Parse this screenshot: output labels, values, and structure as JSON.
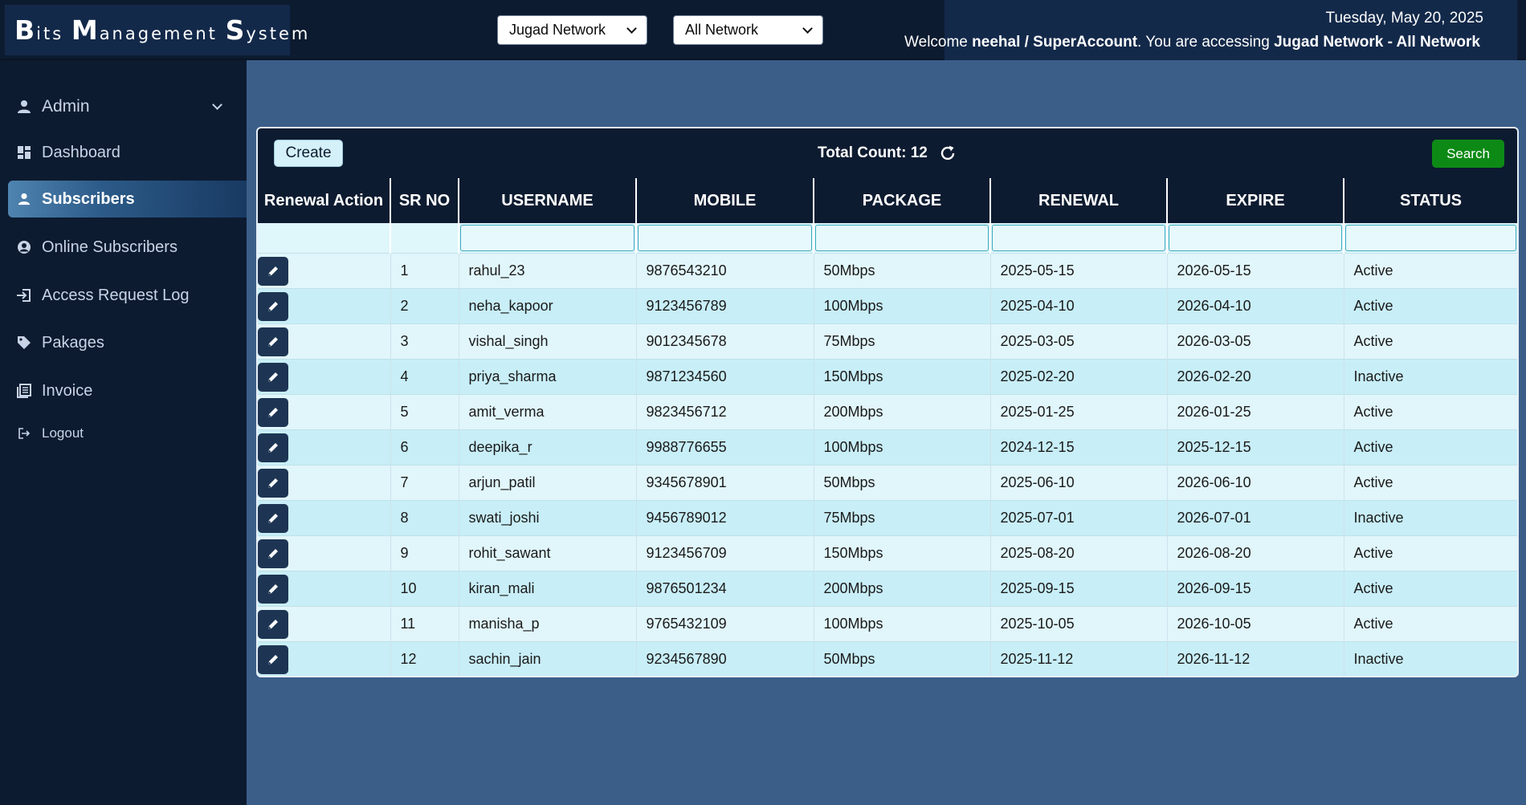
{
  "header": {
    "brand": {
      "b": "B",
      "its": "its ",
      "m": "M",
      "anagement": "anagement ",
      "s": "S",
      "ystem": "ystem"
    },
    "network_select": "Jugad Network",
    "subnetwork_select": "All Network",
    "date": "Tuesday, May 20, 2025",
    "welcome_prefix": "Welcome ",
    "user": "neehal / SuperAccount",
    "accessing_text": ". You are accessing ",
    "access_scope": "Jugad Network - All Network"
  },
  "sidebar": {
    "items": [
      {
        "label": "Admin",
        "icon": "user-icon"
      },
      {
        "label": "Dashboard",
        "icon": "dashboard-icon"
      },
      {
        "label": "Subscribers",
        "icon": "user-icon"
      },
      {
        "label": "Online Subscribers",
        "icon": "user-circle-icon"
      },
      {
        "label": "Access Request Log",
        "icon": "sign-in-icon"
      },
      {
        "label": "Pakages",
        "icon": "tag-icon"
      },
      {
        "label": "Invoice",
        "icon": "invoice-icon"
      },
      {
        "label": "Logout",
        "icon": "logout-icon"
      }
    ]
  },
  "toolbar": {
    "create_label": "Create",
    "total_count": "Total Count: 12",
    "search_label": "Search"
  },
  "table": {
    "headers": [
      "Renewal Action",
      "SR NO",
      "USERNAME",
      "MOBILE",
      "PACKAGE",
      "RENEWAL",
      "EXPIRE",
      "STATUS"
    ],
    "rows": [
      {
        "sr": "1",
        "username": "rahul_23",
        "mobile": "9876543210",
        "package": "50Mbps",
        "renewal": "2025-05-15",
        "expire": "2026-05-15",
        "status": "Active"
      },
      {
        "sr": "2",
        "username": "neha_kapoor",
        "mobile": "9123456789",
        "package": "100Mbps",
        "renewal": "2025-04-10",
        "expire": "2026-04-10",
        "status": "Active"
      },
      {
        "sr": "3",
        "username": "vishal_singh",
        "mobile": "9012345678",
        "package": "75Mbps",
        "renewal": "2025-03-05",
        "expire": "2026-03-05",
        "status": "Active"
      },
      {
        "sr": "4",
        "username": "priya_sharma",
        "mobile": "9871234560",
        "package": "150Mbps",
        "renewal": "2025-02-20",
        "expire": "2026-02-20",
        "status": "Inactive"
      },
      {
        "sr": "5",
        "username": "amit_verma",
        "mobile": "9823456712",
        "package": "200Mbps",
        "renewal": "2025-01-25",
        "expire": "2026-01-25",
        "status": "Active"
      },
      {
        "sr": "6",
        "username": "deepika_r",
        "mobile": "9988776655",
        "package": "100Mbps",
        "renewal": "2024-12-15",
        "expire": "2025-12-15",
        "status": "Active"
      },
      {
        "sr": "7",
        "username": "arjun_patil",
        "mobile": "9345678901",
        "package": "50Mbps",
        "renewal": "2025-06-10",
        "expire": "2026-06-10",
        "status": "Active"
      },
      {
        "sr": "8",
        "username": "swati_joshi",
        "mobile": "9456789012",
        "package": "75Mbps",
        "renewal": "2025-07-01",
        "expire": "2026-07-01",
        "status": "Inactive"
      },
      {
        "sr": "9",
        "username": "rohit_sawant",
        "mobile": "9123456709",
        "package": "150Mbps",
        "renewal": "2025-08-20",
        "expire": "2026-08-20",
        "status": "Active"
      },
      {
        "sr": "10",
        "username": "kiran_mali",
        "mobile": "9876501234",
        "package": "200Mbps",
        "renewal": "2025-09-15",
        "expire": "2026-09-15",
        "status": "Active"
      },
      {
        "sr": "11",
        "username": "manisha_p",
        "mobile": "9765432109",
        "package": "100Mbps",
        "renewal": "2025-10-05",
        "expire": "2026-10-05",
        "status": "Active"
      },
      {
        "sr": "12",
        "username": "sachin_jain",
        "mobile": "9234567890",
        "package": "50Mbps",
        "renewal": "2025-11-12",
        "expire": "2026-11-12",
        "status": "Inactive"
      }
    ]
  },
  "colors": {
    "header_bg": "#0d1b30",
    "content_bg": "#3b5e89",
    "row_odd": "#c8eef7",
    "row_even": "#e1f6fb",
    "search_button": "#0d8a16"
  }
}
